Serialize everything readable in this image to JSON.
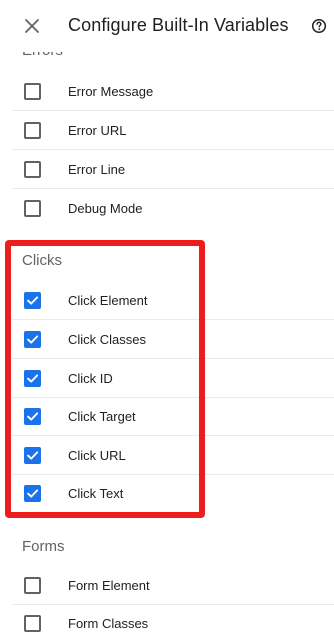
{
  "header": {
    "title": "Configure Built-In Variables",
    "close_icon": "close-icon",
    "help_icon": "help-circle-icon"
  },
  "sections": {
    "errors": {
      "heading": "Errors",
      "items": [
        {
          "label": "Error Message",
          "checked": false
        },
        {
          "label": "Error URL",
          "checked": false
        },
        {
          "label": "Error Line",
          "checked": false
        },
        {
          "label": "Debug Mode",
          "checked": false
        }
      ]
    },
    "clicks": {
      "heading": "Clicks",
      "items": [
        {
          "label": "Click Element",
          "checked": true
        },
        {
          "label": "Click Classes",
          "checked": true
        },
        {
          "label": "Click ID",
          "checked": true
        },
        {
          "label": "Click Target",
          "checked": true
        },
        {
          "label": "Click URL",
          "checked": true
        },
        {
          "label": "Click Text",
          "checked": true
        }
      ]
    },
    "forms": {
      "heading": "Forms",
      "items": [
        {
          "label": "Form Element",
          "checked": false
        },
        {
          "label": "Form Classes",
          "checked": false
        }
      ]
    }
  },
  "colors": {
    "checkbox_checked": "#1a73e8",
    "highlight_border": "#ee1c1c"
  }
}
